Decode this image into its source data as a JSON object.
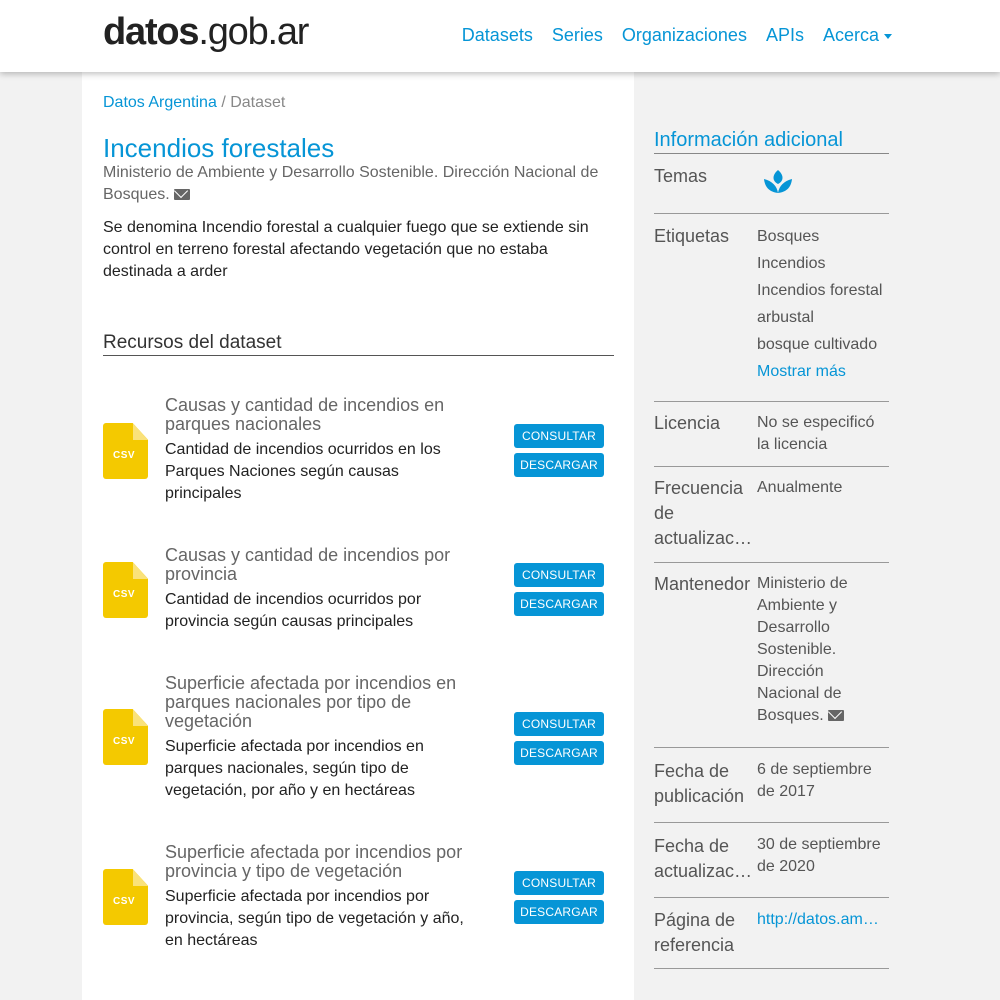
{
  "header": {
    "logo_bold": "datos",
    "logo_rest": ".gob.ar",
    "nav": [
      "Datasets",
      "Series",
      "Organizaciones",
      "APIs",
      "Acerca"
    ]
  },
  "breadcrumb": {
    "home": "Datos Argentina",
    "separator": "/",
    "current": "Dataset"
  },
  "dataset": {
    "title": "Incendios forestales",
    "org": "Ministerio de Ambiente y Desarrollo Sostenible. Dirección Nacional de Bosques.",
    "description": "Se denomina Incendio forestal a cualquier fuego que se extiende sin control en terreno forestal afectando vegetación que no estaba destinada a arder"
  },
  "resources_title": "Recursos del dataset",
  "resources": [
    {
      "format": "CSV",
      "title": "Causas y cantidad de incendios en parques nacionales",
      "description": "Cantidad de incendios ocurridos en los Parques Naciones según causas principales",
      "consult": "CONSULTAR",
      "download": "DESCARGAR"
    },
    {
      "format": "CSV",
      "title": "Causas y cantidad de incendios por provincia",
      "description": "Cantidad de incendios ocurridos por provincia según causas principales",
      "consult": "CONSULTAR",
      "download": "DESCARGAR"
    },
    {
      "format": "CSV",
      "title": "Superficie afectada por incendios en parques nacionales por tipo de vegetación",
      "description": "Superficie afectada por incendios en parques nacionales, según tipo de vegetación, por año y en hectáreas",
      "consult": "CONSULTAR",
      "download": "DESCARGAR"
    },
    {
      "format": "CSV",
      "title": "Superficie afectada por incendios por provincia y tipo de vegetación",
      "description": "Superficie afectada por incendios por provincia, según tipo de vegetación y año, en hectáreas",
      "consult": "CONSULTAR",
      "download": "DESCARGAR"
    }
  ],
  "sidebar": {
    "title": "Información adicional",
    "temas_label": "Temas",
    "temas_icon": "leaf-icon",
    "etiquetas_label": "Etiquetas",
    "tags": [
      "Bosques",
      "Incendios",
      "Incendios forestal",
      "arbustal",
      "bosque cultivado"
    ],
    "show_more": "Mostrar más",
    "licencia_label": "Licencia",
    "licencia_value": "No se especificó la licencia",
    "frecuencia_label_1": "Frecuencia",
    "frecuencia_label_2": "de",
    "frecuencia_label_3": "actualizac…",
    "frecuencia_value": "Anualmente",
    "mantenedor_label": "Mantenedor",
    "mantenedor_value": "Ministerio de Ambiente y Desarrollo Sostenible. Dirección Nacional de Bosques.",
    "publicacion_label": "Fecha de publicación",
    "publicacion_value": "6 de septiembre de 2017",
    "actualizacion_label_1": "Fecha de",
    "actualizacion_label_2": "actualizac…",
    "actualizacion_value": "30 de septiembre de 2020",
    "pagina_label": "Página de referencia",
    "pagina_value": "http://datos.am…"
  },
  "colors": {
    "accent": "#0695d6",
    "csv": "#f4c900"
  }
}
